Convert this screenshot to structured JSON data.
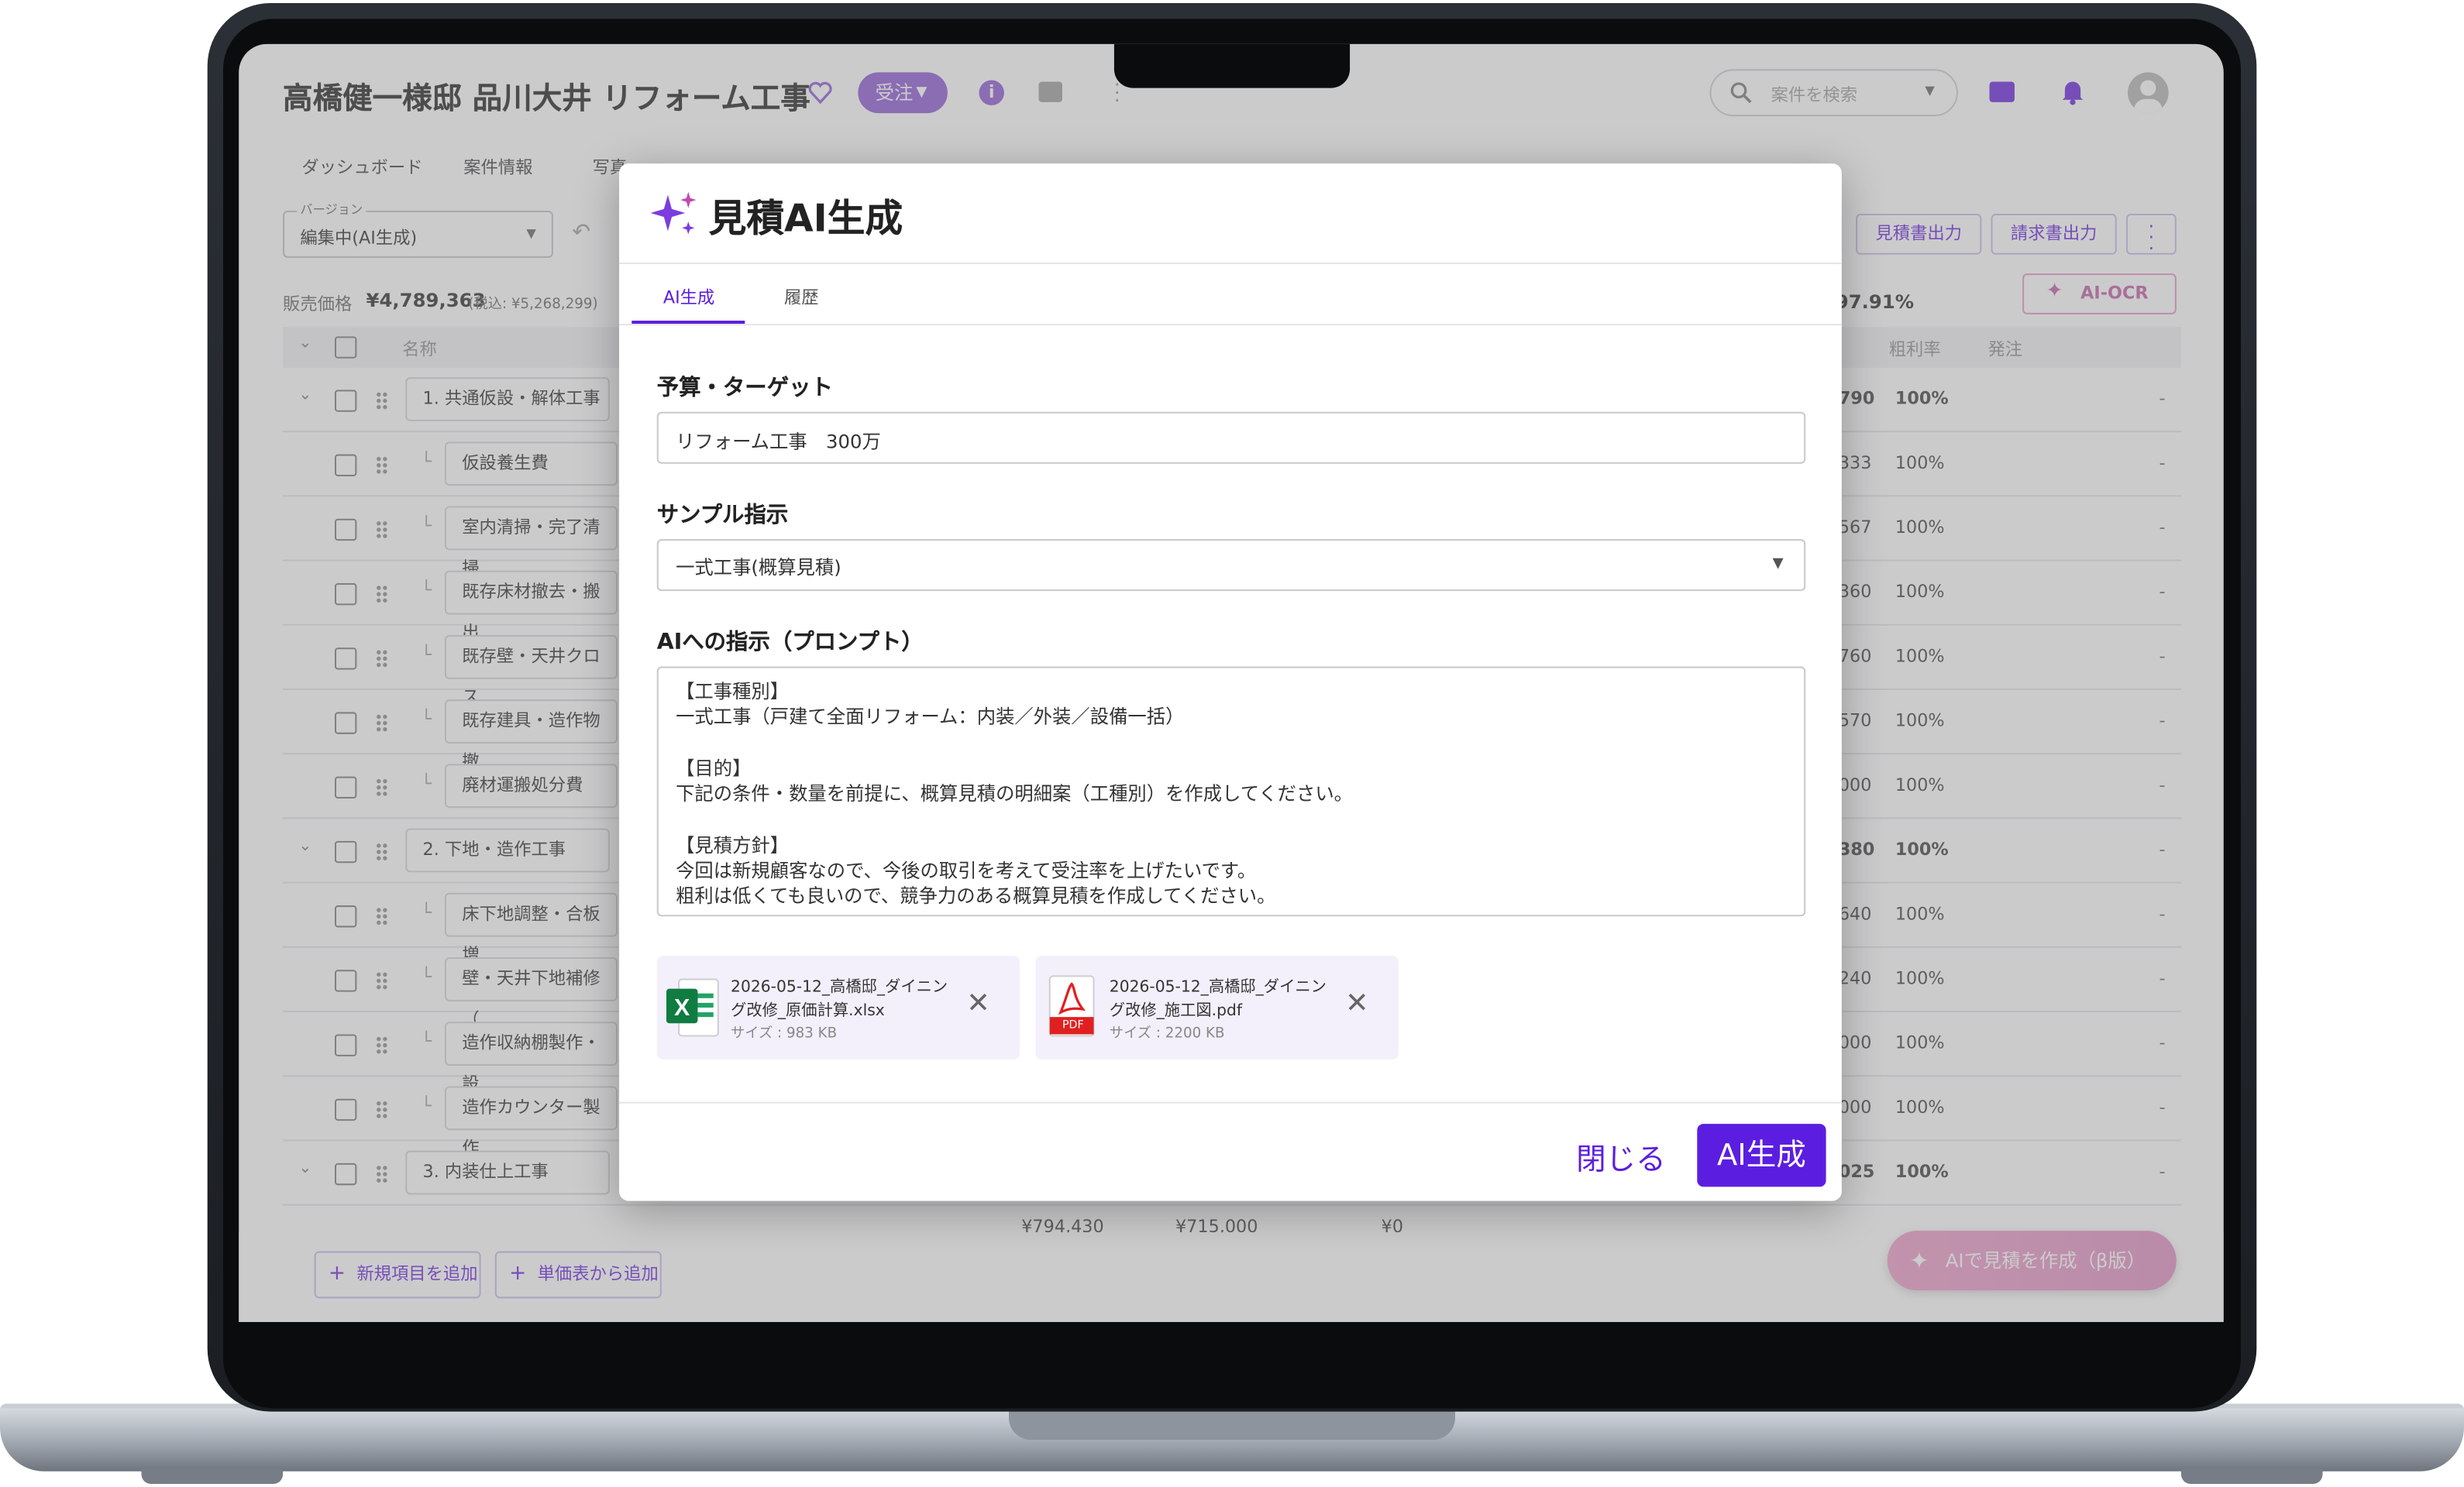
{
  "app": {
    "project_title": "高橋健一様邸 品川大井 リフォーム工事",
    "status_badge": "受注",
    "search_placeholder": "案件を検索"
  },
  "tabs": [
    "ダッシュボード",
    "案件情報",
    "写真"
  ],
  "version": {
    "label": "バージョン",
    "value": "編集中(AI生成)"
  },
  "toolbar": {
    "estimate_output": "見積書出力",
    "invoice_output": "請求書出力",
    "ai_ocr": "AI-OCR"
  },
  "price": {
    "label": "販売価格",
    "value": "¥4,789,363",
    "tax": "(税込: ¥5,268,299)",
    "margin": "97.91%"
  },
  "table": {
    "headers": {
      "name": "名称",
      "margin_rate": "粗利率",
      "order": "発注"
    },
    "rows": [
      {
        "name": "1. 共通仮設・解体工事",
        "value_tail": "790",
        "rate": "100%",
        "order": "-",
        "group": true
      },
      {
        "name": "仮設養生費",
        "value_tail": "333",
        "rate": "100%",
        "order": "-",
        "group": false
      },
      {
        "name": "室内清掃・完了清掃",
        "value_tail": "567",
        "rate": "100%",
        "order": "-",
        "group": false
      },
      {
        "name": "既存床材撤去・搬出",
        "value_tail": "360",
        "rate": "100%",
        "order": "-",
        "group": false
      },
      {
        "name": "既存壁・天井クロス",
        "value_tail": "760",
        "rate": "100%",
        "order": "-",
        "group": false
      },
      {
        "name": "既存建具・造作物撤",
        "value_tail": "570",
        "rate": "100%",
        "order": "-",
        "group": false
      },
      {
        "name": "廃材運搬処分費",
        "value_tail": "000",
        "rate": "100%",
        "order": "-",
        "group": false
      },
      {
        "name": "2. 下地・造作工事",
        "value_tail": "380",
        "rate": "100%",
        "order": "-",
        "group": true
      },
      {
        "name": "床下地調整・合板増",
        "value_tail": "640",
        "rate": "100%",
        "order": "-",
        "group": false
      },
      {
        "name": "壁・天井下地補修（",
        "value_tail": "240",
        "rate": "100%",
        "order": "-",
        "group": false
      },
      {
        "name": "造作収納棚製作・設",
        "value_tail": "000",
        "rate": "100%",
        "order": "-",
        "group": false
      },
      {
        "name": "造作カウンター製作",
        "value_tail": "000",
        "rate": "100%",
        "order": "-",
        "group": false
      },
      {
        "name": "3. 内装仕上工事",
        "value_tail": "025",
        "rate": "100%",
        "order": "-",
        "group": true
      }
    ],
    "partial_row": {
      "a": "¥794,430",
      "b": "¥715,000",
      "c": "¥0"
    }
  },
  "bottom": {
    "add_item": "新規項目を追加",
    "add_from_price_list": "単価表から追加",
    "ai_create": "AIで見積を作成（β版）"
  },
  "modal": {
    "title": "見積AI生成",
    "tabs": [
      "AI生成",
      "履歴"
    ],
    "budget_label": "予算・ターゲット",
    "budget_value": "リフォーム工事　300万",
    "sample_label": "サンプル指示",
    "sample_value": "一式工事(概算見積)",
    "prompt_label": "AIへの指示（プロンプト）",
    "prompt_lines": [
      "【工事種別】",
      "一式工事（戸建て全面リフォーム：内装／外装／設備一括）",
      "",
      "【目的】",
      "下記の条件・数量を前提に、概算見積の明細案（工種別）を作成してください。",
      "",
      "【見積方針】",
      "今回は新規顧客なので、今後の取引を考えて受注率を上げたいです。",
      "粗利は低くても良いので、競争力のある概算見積を作成してください。"
    ],
    "files": [
      {
        "name1": "2026-05-12_高橋邸_ダイニン",
        "name2": "グ改修_原価計算.xlsx",
        "size": "サイズ : 983 KB",
        "icon": "excel-icon"
      },
      {
        "name1": "2026-05-12_高橋邸_ダイニン",
        "name2": "グ改修_施工図.pdf",
        "size": "サイズ : 2200 KB",
        "icon": "pdf-icon",
        "badge": "PDF"
      }
    ],
    "close_label": "閉じる",
    "generate_label": "AI生成"
  },
  "colors": {
    "accent": "#5b1ee0",
    "badge": "#9b6dd8",
    "pink": "#e9a1cc"
  }
}
